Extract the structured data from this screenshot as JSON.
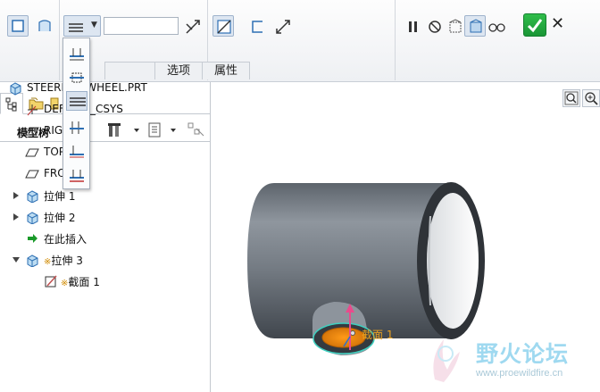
{
  "dashboard": {
    "depth_value": "",
    "tabs": [
      "",
      "选项",
      "属性"
    ]
  },
  "panel": {
    "tree_title": "模型树"
  },
  "tree": [
    {
      "label": "STEERING_WHEEL.PRT",
      "icon": "part-icon",
      "expand": false,
      "star": false
    },
    {
      "label": "DEFAULT_CSYS",
      "icon": "csys-icon",
      "expand": false,
      "star": false
    },
    {
      "label": "RIGHT",
      "icon": "datum-plane-icon",
      "expand": false,
      "star": false
    },
    {
      "label": "TOP",
      "icon": "datum-plane-icon",
      "expand": false,
      "star": false
    },
    {
      "label": "FRONT",
      "icon": "datum-plane-icon",
      "expand": false,
      "star": false
    },
    {
      "label": "拉伸 1",
      "icon": "extrude-icon",
      "expand": "collapsed",
      "star": false
    },
    {
      "label": "拉伸 2",
      "icon": "extrude-icon",
      "expand": "collapsed",
      "star": false
    },
    {
      "label": "在此插入",
      "icon": "insert-here-icon",
      "expand": false,
      "star": false
    },
    {
      "label": "拉伸 3",
      "icon": "extrude-icon",
      "expand": "expanded",
      "star": true
    },
    {
      "label": "截面 1",
      "icon": "sketch-icon",
      "expand": false,
      "star": true
    }
  ],
  "graphics": {
    "section_label": "截面 1",
    "watermark_cn": "野火论坛",
    "watermark_url": "www.proewildfire.cn"
  },
  "colors": {
    "accent_green": "#1fa53c",
    "model_gray": "#8a9199",
    "section_orange": "#f0a020",
    "label_orange": "#e8a020"
  }
}
